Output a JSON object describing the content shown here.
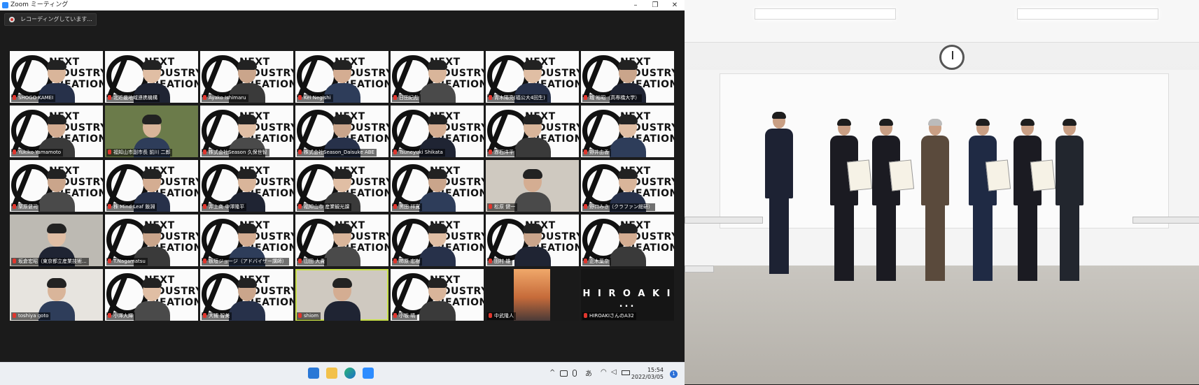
{
  "window": {
    "title": "Zoom ミーティング",
    "minimize": "–",
    "maximize": "❐",
    "close": "✕"
  },
  "recording": {
    "label": "レコーディングしています..."
  },
  "participants": [
    {
      "name": "SHOGO KAMEI",
      "style": "logo"
    },
    {
      "name": "北近畿地域連携機構",
      "style": "logo"
    },
    {
      "name": "Ayako Ishimaru",
      "style": "logo"
    },
    {
      "name": "Kei Negishi",
      "style": "logo"
    },
    {
      "name": "日田紀彪",
      "style": "logo"
    },
    {
      "name": "青木陽亮(福公大4回生)",
      "style": "logo"
    },
    {
      "name": "城 裕昭（高専橋大学）",
      "style": "logo"
    },
    {
      "name": "Yukiko Yamamoto",
      "style": "logo"
    },
    {
      "name": "福知山市副市長 前川 二郎",
      "style": "green"
    },
    {
      "name": "株式会社Season 久保世智",
      "style": "logo"
    },
    {
      "name": "株式会社Season_Daisuke ABE",
      "style": "logo"
    },
    {
      "name": "Tsuneyuki Shikata",
      "style": "logo"
    },
    {
      "name": "赤石洋平",
      "style": "logo"
    },
    {
      "name": "野井由香",
      "style": "logo"
    },
    {
      "name": "栗原健司",
      "style": "logo"
    },
    {
      "name": "株 Mind Leaf 飯淵",
      "style": "logo"
    },
    {
      "name": "井上商 中澤隆平",
      "style": "logo"
    },
    {
      "name": "福知山市 産業観光課",
      "style": "logo"
    },
    {
      "name": "黒田 祥寛",
      "style": "logo"
    },
    {
      "name": "松原 健一",
      "style": "room"
    },
    {
      "name": "野口みき（クラファン総研）",
      "style": "logo"
    },
    {
      "name": "坂倉宏昭（東京都立産業技術...",
      "style": "gray"
    },
    {
      "name": "T.Nagamatsu",
      "style": "logo"
    },
    {
      "name": "板垣ジョージ（アドバイザー講師）",
      "style": "logo"
    },
    {
      "name": "山田 大貴",
      "style": "logo"
    },
    {
      "name": "柿原 宏樹",
      "style": "logo"
    },
    {
      "name": "田村 雄",
      "style": "logo"
    },
    {
      "name": "正木葉奈",
      "style": "logo"
    },
    {
      "name": "toshiya goto",
      "style": "office"
    },
    {
      "name": "小澤大輝",
      "style": "logo"
    },
    {
      "name": "大槻 智美",
      "style": "logo"
    },
    {
      "name": "shiom",
      "style": "room"
    },
    {
      "name": "小坂 晴",
      "style": "logo"
    },
    {
      "name": "中武隆人",
      "style": "sunset"
    },
    {
      "name": "HIROAKIさんのA32",
      "style": "black",
      "big": "H I R O A K I ..."
    }
  ],
  "tile_brand": "NEXT\nINDUSTRY\nCREATION",
  "taskbar": {
    "time": "15:54",
    "date": "2022/03/05",
    "ime": "あ",
    "notifications": "1",
    "tray_chevron": "^",
    "apps": [
      "windows-start",
      "file-explorer",
      "edge",
      "zoom"
    ]
  },
  "photo": {
    "people_count": 7
  }
}
